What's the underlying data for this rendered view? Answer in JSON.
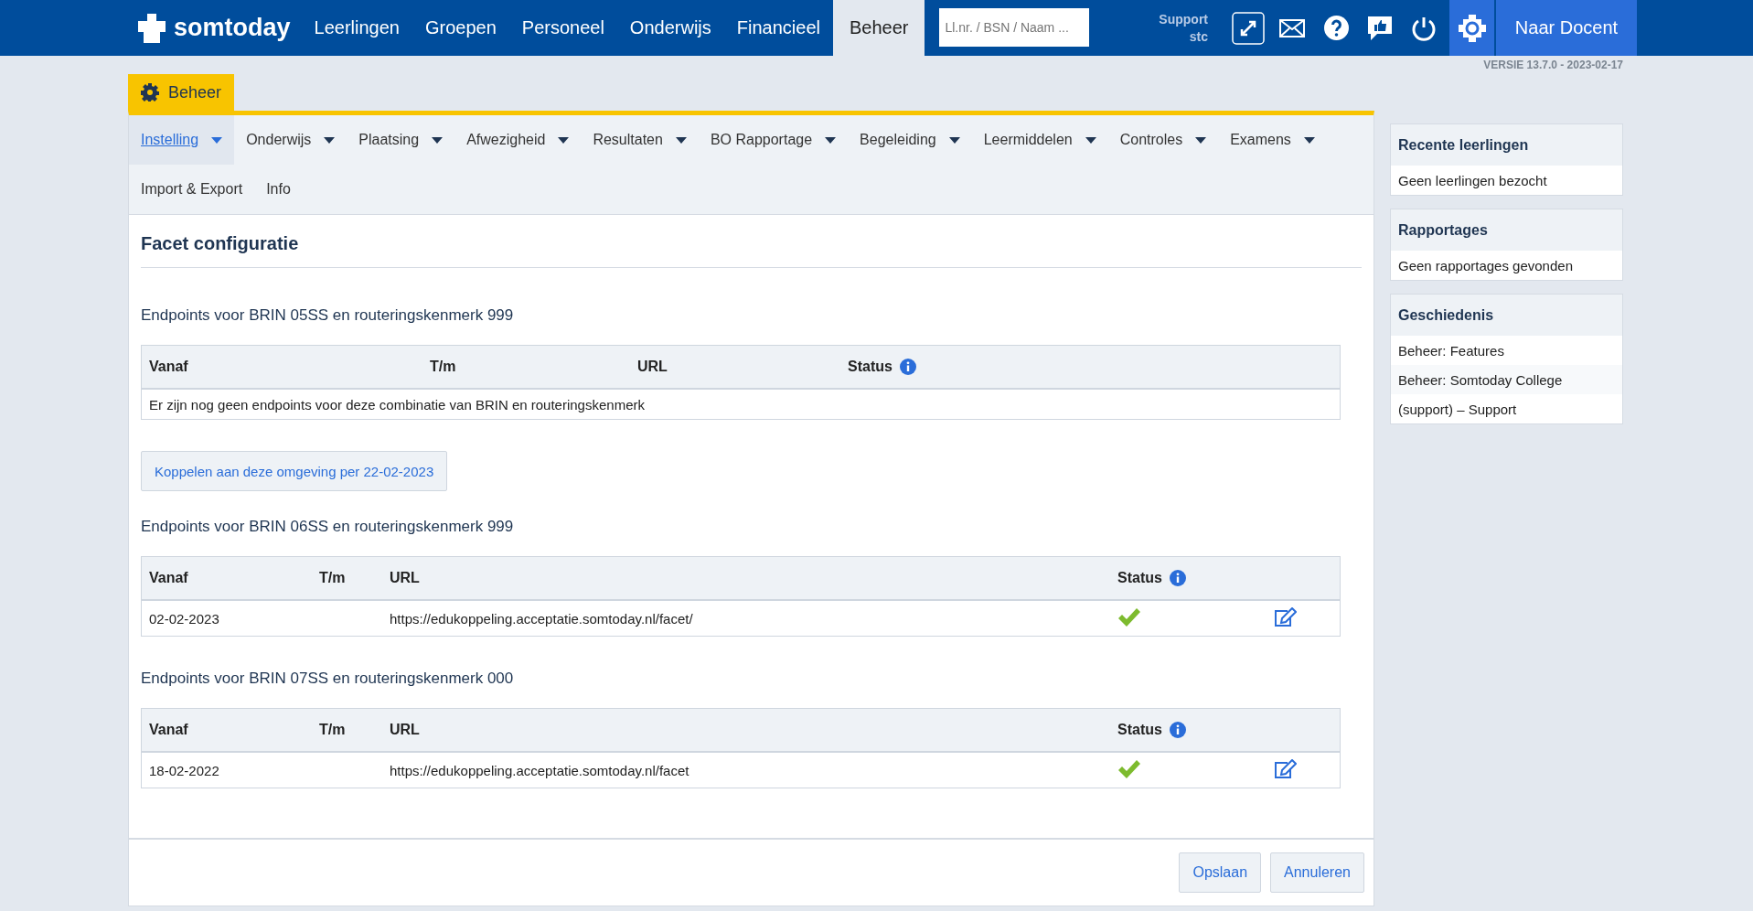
{
  "topbar": {
    "logo": "somtoday",
    "nav": [
      {
        "label": "Leerlingen",
        "selected": false
      },
      {
        "label": "Groepen",
        "selected": false
      },
      {
        "label": "Personeel",
        "selected": false
      },
      {
        "label": "Onderwijs",
        "selected": false
      },
      {
        "label": "Financieel",
        "selected": false
      },
      {
        "label": "Beheer",
        "selected": true
      }
    ],
    "search": {
      "placeholder": "Ll.nr. / BSN / Naam ..."
    },
    "support": [
      "Support",
      "stc"
    ],
    "button": "Naar Docent"
  },
  "version": "VERSIE 13.7.0 - 2023-02-17",
  "section_tab": "Beheer",
  "submenu": [
    {
      "label": "Instelling",
      "dropdown": true,
      "selected": true
    },
    {
      "label": "Onderwijs",
      "dropdown": true,
      "selected": false
    },
    {
      "label": "Plaatsing",
      "dropdown": true,
      "selected": false
    },
    {
      "label": "Afwezigheid",
      "dropdown": true,
      "selected": false
    },
    {
      "label": "Resultaten",
      "dropdown": true,
      "selected": false
    },
    {
      "label": "BO Rapportage",
      "dropdown": true,
      "selected": false
    },
    {
      "label": "Begeleiding",
      "dropdown": true,
      "selected": false
    },
    {
      "label": "Leermiddelen",
      "dropdown": true,
      "selected": false
    },
    {
      "label": "Controles",
      "dropdown": true,
      "selected": false
    },
    {
      "label": "Examens",
      "dropdown": true,
      "selected": false
    },
    {
      "label": "Import & Export",
      "dropdown": false,
      "selected": false
    },
    {
      "label": "Info",
      "dropdown": false,
      "selected": false
    }
  ],
  "page_title": "Facet configuratie",
  "sections": [
    {
      "heading": "Endpoints voor BRIN 05SS en routeringskenmerk 999",
      "kind": "empty",
      "columns": [
        "Vanaf",
        "T/m",
        "URL",
        "Status"
      ],
      "empty_message": "Er zijn nog geen endpoints voor deze combinatie van BRIN en routeringskenmerk",
      "action": "Koppelen aan deze omgeving per 22-02-2023"
    },
    {
      "heading": "Endpoints voor BRIN 06SS en routeringskenmerk 999",
      "kind": "list",
      "columns": [
        "Vanaf",
        "T/m",
        "URL",
        "Status"
      ],
      "rows": [
        {
          "vanaf": "02-02-2023",
          "url": "https://edukoppeling.acceptatie.somtoday.nl/facet/",
          "status_ok": true
        }
      ]
    },
    {
      "heading": "Endpoints voor BRIN 07SS en routeringskenmerk 000",
      "kind": "list",
      "columns": [
        "Vanaf",
        "T/m",
        "URL",
        "Status"
      ],
      "rows": [
        {
          "vanaf": "18-02-2022",
          "url": "https://edukoppeling.acceptatie.somtoday.nl/facet",
          "status_ok": true
        }
      ]
    }
  ],
  "footer_buttons": [
    "Opslaan",
    "Annuleren"
  ],
  "sidebar": [
    {
      "title": "Recente leerlingen",
      "items": [
        "Geen leerlingen bezocht"
      ]
    },
    {
      "title": "Rapportages",
      "items": [
        "Geen rapportages gevonden"
      ]
    },
    {
      "title": "Geschiedenis",
      "items": [
        "Beheer: Features",
        "Beheer: Somtoday College",
        "(support) – Support"
      ]
    }
  ]
}
